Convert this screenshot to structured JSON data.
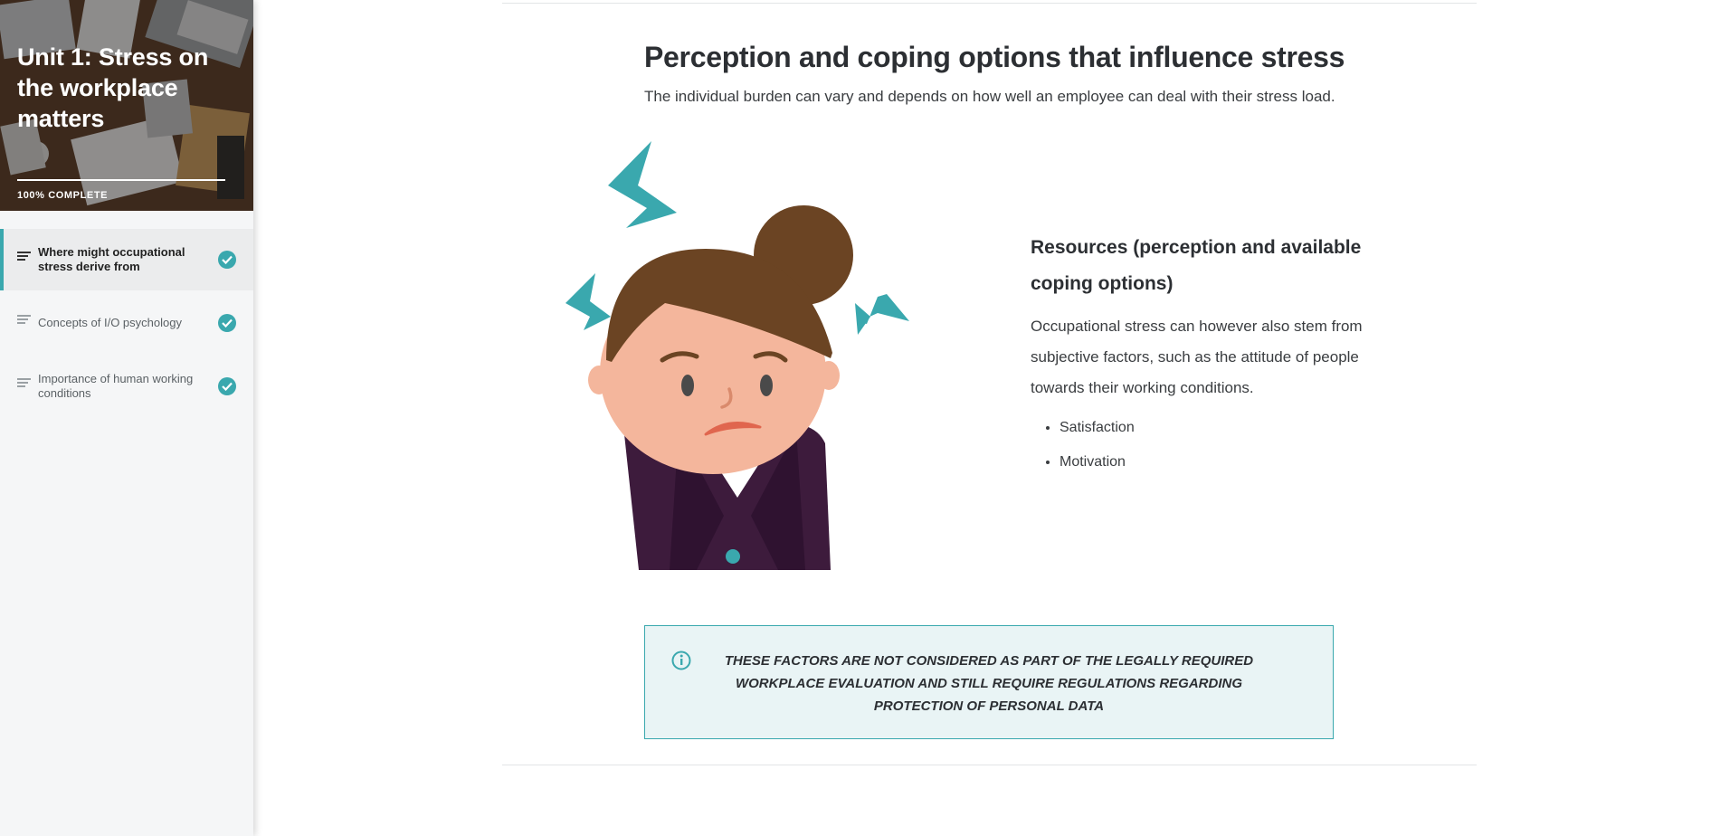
{
  "sidebar": {
    "course_title": "Unit 1: Stress on the workplace matters",
    "progress": {
      "percent": 100,
      "label": "100% COMPLETE"
    },
    "lessons": [
      {
        "label": "Where might occupational stress derive from",
        "completed": true,
        "active": true
      },
      {
        "label": "Concepts of I/O psychology",
        "completed": true,
        "active": false
      },
      {
        "label": "Importance of human working conditions",
        "completed": true,
        "active": false
      }
    ]
  },
  "main": {
    "title": "Perception and coping options that influence stress",
    "subtitle": "The individual burden can vary and depends on how well an employee can deal with their stress load.",
    "resources": {
      "heading": "Resources (perception and available coping options)",
      "body": "Occupational stress can however also stem from subjective factors, such as the attitude of people towards their working conditions.",
      "bullets": [
        "Satisfaction",
        "Motivation"
      ]
    },
    "note": {
      "icon": "info-icon",
      "text": "These factors are not considered as part of the legally required workplace evaluation and still require regulations regarding protection of personal data"
    }
  },
  "colors": {
    "accent": "#3aa8ae",
    "note_bg": "#e9f4f5",
    "text": "#2c2f33",
    "sidebar_bg": "#f5f6f7"
  }
}
